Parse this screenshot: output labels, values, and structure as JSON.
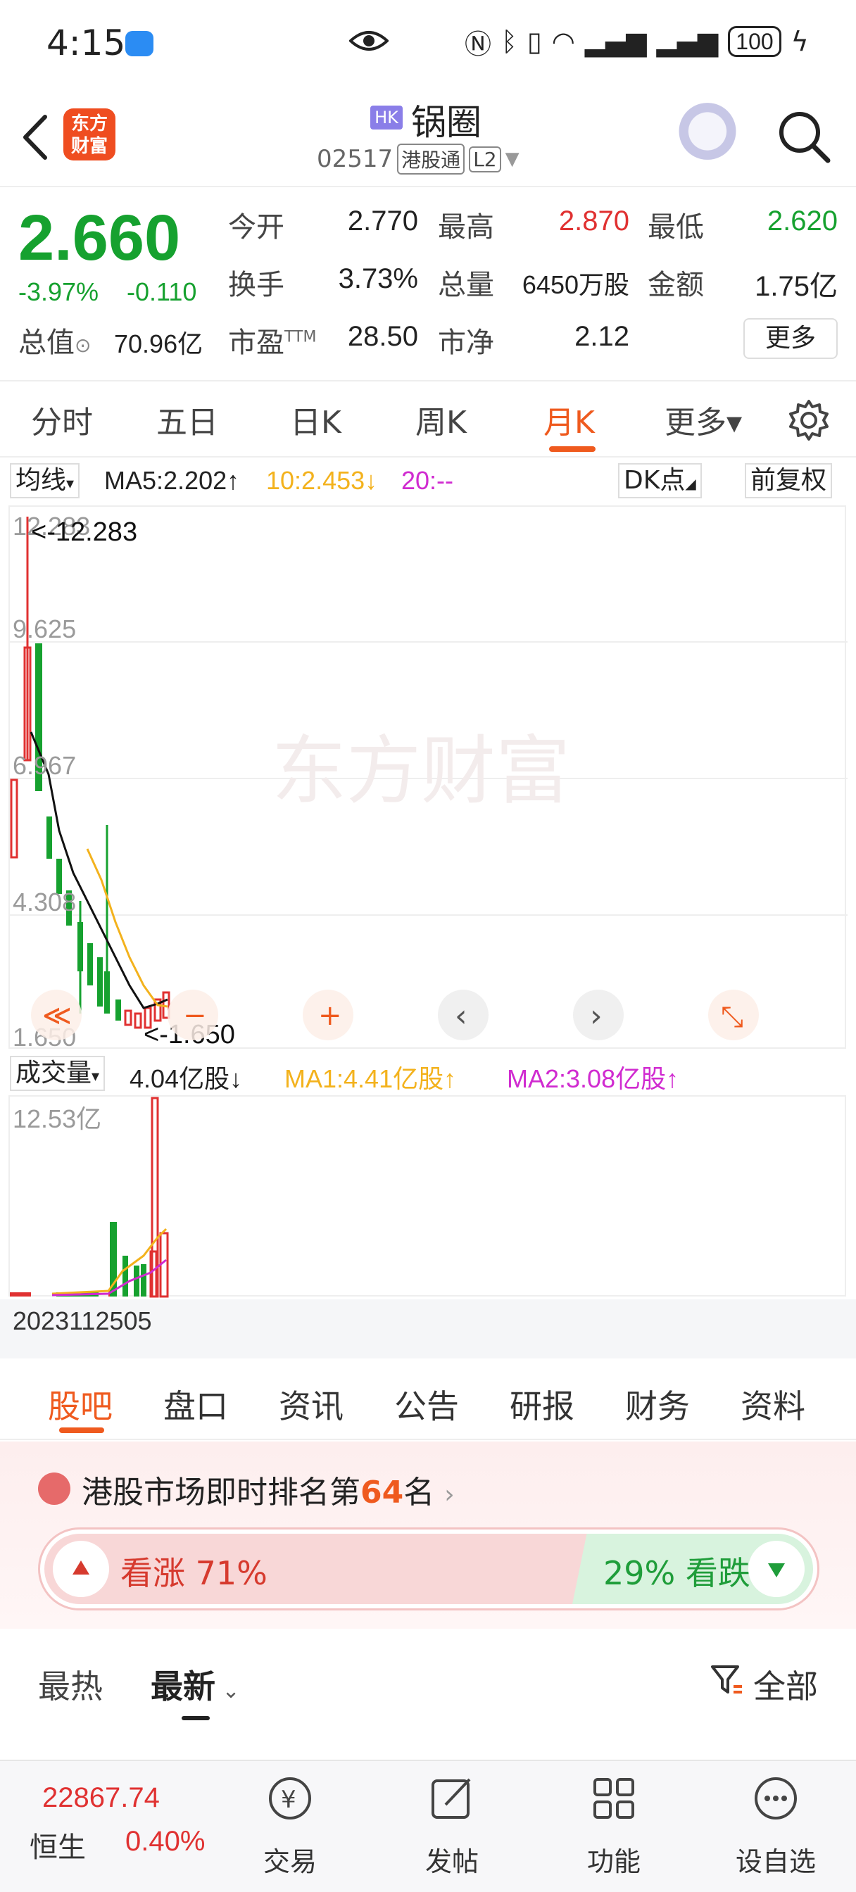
{
  "status_bar": {
    "time": "4:15",
    "battery": "100"
  },
  "header": {
    "logo_text": "东方财富",
    "market_badge": "HK",
    "stock_name": "锅圈",
    "stock_code": "02517",
    "tag_connect": "港股通",
    "tag_level": "L2"
  },
  "quote": {
    "price": "2.660",
    "change_pct": "-3.97%",
    "change_abs": "-0.110",
    "market_cap_label": "总值",
    "market_cap_value": "70.96亿",
    "open_label": "今开",
    "open_value": "2.770",
    "high_label": "最高",
    "high_value": "2.870",
    "low_label": "最低",
    "low_value": "2.620",
    "turnover_label": "换手",
    "turnover_value": "3.73%",
    "volume_label": "总量",
    "volume_value": "6450万股",
    "amount_label": "金额",
    "amount_value": "1.75亿",
    "pe_label": "市盈",
    "pe_suffix": "TTM",
    "pe_value": "28.50",
    "pb_label": "市净",
    "pb_value": "2.12",
    "more_label": "更多"
  },
  "period_tabs": [
    {
      "label": "分时"
    },
    {
      "label": "五日"
    },
    {
      "label": "日K"
    },
    {
      "label": "周K"
    },
    {
      "label": "月K",
      "active": true
    },
    {
      "label": "更多▾"
    }
  ],
  "ma_bar": {
    "select_label": "均线",
    "ma5": "MA5:2.202↑",
    "ma10": "10:2.453↓",
    "ma20": "20:--",
    "dk_label": "DK点",
    "adjust_label": "前复权"
  },
  "kline": {
    "watermark": "东方财富",
    "y_ticks": [
      "12.283",
      "9.625",
      "6.967",
      "4.308",
      "1.650"
    ],
    "max_marker": "<-12.283",
    "min_marker": "<-1.650",
    "controls": [
      "≪",
      "−",
      "+",
      "‹",
      "›",
      "⤡"
    ]
  },
  "volume": {
    "select_label": "成交量",
    "value": "4.04亿股↓",
    "ma1": "MA1:4.41亿股↑",
    "ma2": "MA2:3.08亿股↑",
    "y_max": "12.53亿",
    "date_start": "202311",
    "date_end": "2505"
  },
  "colors": {
    "up": "#e03131",
    "down": "#16a12f",
    "accent": "#ef5a1e",
    "ma10": "#f3b21d",
    "ma20": "#d02bd0"
  },
  "content_tabs": [
    {
      "label": "股吧",
      "active": true
    },
    {
      "label": "盘口"
    },
    {
      "label": "资讯"
    },
    {
      "label": "公告"
    },
    {
      "label": "研报"
    },
    {
      "label": "财务"
    },
    {
      "label": "资料"
    }
  ],
  "rank": {
    "prefix": "港股市场即时排名第",
    "number": "64",
    "suffix": "名"
  },
  "sentiment": {
    "up_label": "看涨 71%",
    "down_label": "29% 看跌",
    "up_pct": 71,
    "down_pct": 29
  },
  "filter": {
    "hot": "最热",
    "latest": "最新",
    "all": "全部"
  },
  "bottom_nav": {
    "index_value": "22867.74",
    "index_name": "恒生",
    "index_change": "0.40%",
    "items": [
      {
        "label": "交易"
      },
      {
        "label": "发帖"
      },
      {
        "label": "功能"
      },
      {
        "label": "设自选"
      }
    ]
  }
}
